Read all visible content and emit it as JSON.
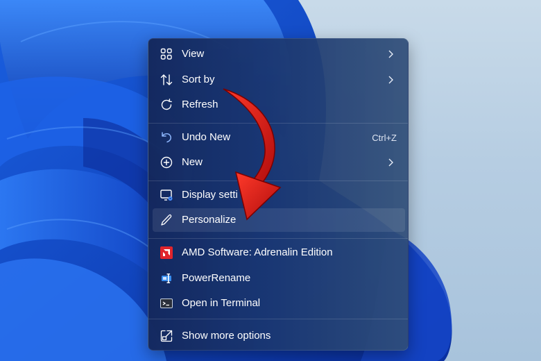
{
  "context_menu": {
    "items": [
      {
        "name": "view",
        "label": "View",
        "icon": "grid-view-icon",
        "submenu": true
      },
      {
        "name": "sort-by",
        "label": "Sort by",
        "icon": "sort-arrows-icon",
        "submenu": true
      },
      {
        "name": "refresh",
        "label": "Refresh",
        "icon": "refresh-icon"
      },
      {
        "name": "undo-new",
        "label": "Undo New",
        "icon": "undo-icon",
        "shortcut": "Ctrl+Z"
      },
      {
        "name": "new",
        "label": "New",
        "icon": "plus-circle-icon",
        "submenu": true
      },
      {
        "name": "display-settings",
        "label": "Display setti",
        "icon": "display-settings-icon"
      },
      {
        "name": "personalize",
        "label": "Personalize",
        "icon": "pen-icon",
        "highlighted": true
      },
      {
        "name": "amd-software",
        "label": "AMD Software: Adrenalin Edition",
        "icon": "amd-logo-icon"
      },
      {
        "name": "powerrename",
        "label": "PowerRename",
        "icon": "powerrename-icon"
      },
      {
        "name": "open-in-terminal",
        "label": "Open in Terminal",
        "icon": "terminal-icon"
      },
      {
        "name": "show-more-options",
        "label": "Show more options",
        "icon": "show-more-icon"
      }
    ]
  },
  "annotation": {
    "arrow_color": "#e0201c",
    "icon": "red-curved-arrow-icon"
  },
  "colors": {
    "accent_icon": "#8fb8ff",
    "menu_text": "#ffffff",
    "amd_red": "#e0242c"
  }
}
